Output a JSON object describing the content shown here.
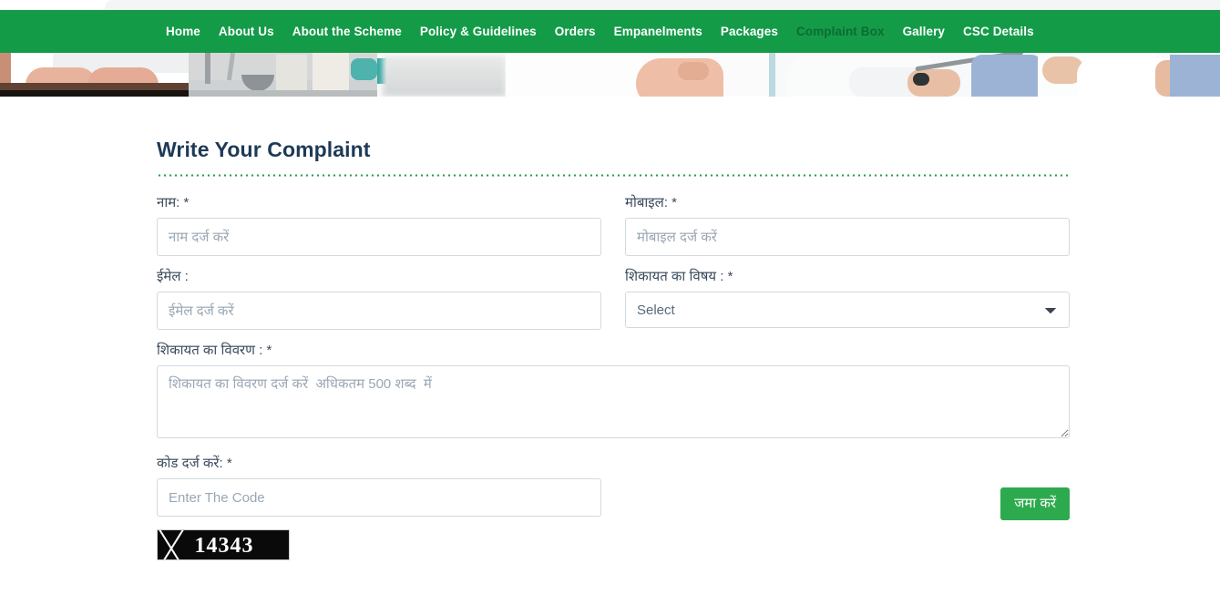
{
  "nav": {
    "items": [
      {
        "label": "Home",
        "active": false
      },
      {
        "label": "About Us",
        "active": false
      },
      {
        "label": "About the Scheme",
        "active": false
      },
      {
        "label": "Policy & Guidelines",
        "active": false
      },
      {
        "label": "Orders",
        "active": false
      },
      {
        "label": "Empanelments",
        "active": false
      },
      {
        "label": "Packages",
        "active": false
      },
      {
        "label": "Complaint Box",
        "active": true
      },
      {
        "label": "Gallery",
        "active": false
      },
      {
        "label": "CSC Details",
        "active": false
      }
    ],
    "background_color": "#149b48",
    "link_color": "#ffffff",
    "active_link_color": "#0d6b33"
  },
  "banner": {
    "description": "medical photo strip"
  },
  "form": {
    "title": "Write Your Complaint",
    "title_color": "#1d3a57",
    "divider_color": "#2c9e4f",
    "name": {
      "label": "नाम: *",
      "placeholder": "नाम दर्ज करें",
      "value": ""
    },
    "mobile": {
      "label": "मोबाइल: *",
      "placeholder": "मोबाइल दर्ज करें",
      "value": ""
    },
    "email": {
      "label": "ईमेल :",
      "placeholder": "ईमेल दर्ज करें",
      "value": ""
    },
    "subject": {
      "label": "शिकायत का विषय : *",
      "selected": "Select",
      "options": [
        "Select"
      ]
    },
    "description": {
      "label": "शिकायत का विवरण : *",
      "placeholder": "शिकायत का विवरण दर्ज करें  अधिकतम 500 शब्द  में",
      "value": ""
    },
    "code": {
      "label": "कोड दर्ज करें: *",
      "placeholder": "Enter The Code",
      "value": ""
    },
    "captcha": {
      "text": "14343",
      "background_color": "#0a0a0a",
      "text_color": "#ffffff"
    },
    "submit": {
      "label": "जमा करें",
      "color": "#2eaa4e"
    }
  }
}
